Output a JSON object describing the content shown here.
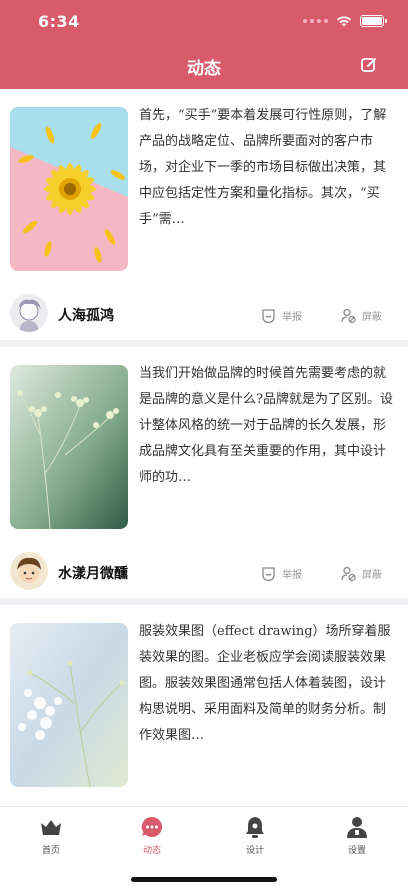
{
  "status_bar": {
    "time": "6:34"
  },
  "header": {
    "title": "动态",
    "edit_icon": "edit-icon",
    "background": "#d95a6a"
  },
  "posts": [
    {
      "text": "首先，“买手”要本着发展可行性原则，了解产品的战略定位、品牌所要面对的客户市场，对企业下一季的市场目标做出决策，其中应包括定性方案和量化指标。其次，“买手”需…",
      "username": "人海孤鸿",
      "report_label": "举报",
      "block_label": "屏蔽"
    },
    {
      "text": "当我们开始做品牌的时候首先需要考虑的就是品牌的意义是什么?品牌就是为了区别。设计整体风格的统一对于品牌的长久发展，形成品牌文化具有至关重要的作用，其中设计师的功…",
      "username": "水漾月微醺",
      "report_label": "举报",
      "block_label": "屏蔽"
    },
    {
      "text": "服装效果图（effect drawing）场所穿着服装效果的图。企业老板应学会阅读服装效果图。服装效果图通常包括人体着装图，设计构思说明、采用面料及简单的财务分析。制作效果图…"
    }
  ],
  "tabs": [
    {
      "label": "首页",
      "icon": "crown-icon"
    },
    {
      "label": "动态",
      "icon": "chat-bubble-icon",
      "active": true
    },
    {
      "label": "设计",
      "icon": "bell-icon"
    },
    {
      "label": "设置",
      "icon": "person-icon"
    }
  ],
  "colors": {
    "accent": "#d95a6a",
    "feed_bg": "#f2f2f6",
    "text": "#333333"
  }
}
